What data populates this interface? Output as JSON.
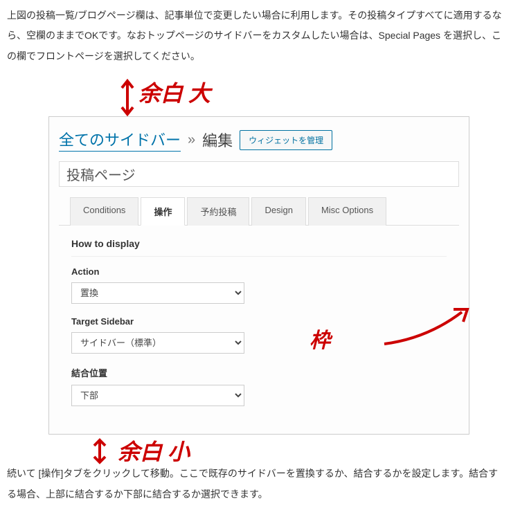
{
  "intro": "上図の投稿一覧/ブログページ欄は、記事単位で変更したい場合に利用します。その投稿タイプすべてに適用するなら、空欄のままでOKです。なおトップページのサイドバーをカスタムしたい場合は、Special Pages を選択し、この欄でフロントページを選択してください。",
  "annotations": {
    "top": "余白 大",
    "frame": "枠",
    "bottom": "余白 小"
  },
  "breadcrumb": {
    "link": "全てのサイドバー",
    "separator": "»",
    "current": "編集"
  },
  "widget_button": "ウィジェットを管理",
  "title_value": "投稿ページ",
  "tabs": {
    "conditions": "Conditions",
    "sousa": "操作",
    "yoyaku": "予約投稿",
    "design": "Design",
    "misc": "Misc Options"
  },
  "section": {
    "heading": "How to display",
    "action_label": "Action",
    "action_value": "置換",
    "target_label": "Target Sidebar",
    "target_value": "サイドバー（標準）",
    "merge_label": "結合位置",
    "merge_value": "下部"
  },
  "outro": "続いて [操作]タブをクリックして移動。ここで既存のサイドバーを置換するか、結合するかを設定します。結合する場合、上部に結合するか下部に結合するか選択できます。"
}
